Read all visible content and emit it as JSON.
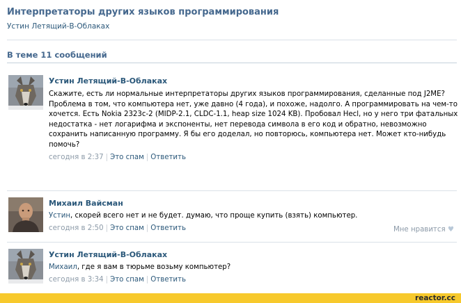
{
  "topic": {
    "title": "Интерпретаторы других языков программирования",
    "author": "Устин Летящий-В-Облаках",
    "count_label": "В теме 11 сообщений"
  },
  "posts": [
    {
      "author": "Устин Летящий-В-Облаках",
      "avatar": "wolf-avatar",
      "text": "Скажите, есть ли нормальные интерпретаторы других языков программирования, сделанные под J2ME?\nПроблема в том, что компьютера нет, уже давно (4 года), и похоже, надолго. А программировать на чем-то хочется. Есть Nokia 2323c-2 (MIDP-2.1, CLDC-1.1, heap size 1024 KB). Пробовал Hecl, но у него три фатальных недостатка - нет логарифма и экспоненты, нет перевода символа в его код и обратно, невозможно сохранить написанную программу. Я бы его доделал, но повторюсь, компьютера нет. Может кто-нибудь помочь?",
      "time": "сегодня в 2:37",
      "spam": "Это спам",
      "reply": "Ответить"
    },
    {
      "author": "Михаил Вайсман",
      "avatar": "man-avatar",
      "reply_to": "Устин",
      "text": ", скорей всего нет и не будет. думаю, что проще купить (взять) компьютер.",
      "time": "сегодня в 2:50",
      "spam": "Это спам",
      "reply": "Ответить",
      "like": "Мне нравится"
    },
    {
      "author": "Устин Летящий-В-Облаках",
      "avatar": "wolf-avatar",
      "reply_to": "Михаил",
      "text": ", где я вам в тюрьме возьму компьютер?",
      "time": "сегодня в 3:34",
      "spam": "Это спам",
      "reply": "Ответить"
    }
  ],
  "footer": {
    "watermark": "reactor.cc"
  },
  "colors": {
    "link": "#2b587a",
    "title": "#45688e",
    "meta": "#8c9aa8",
    "footer": "#f7c92c"
  }
}
